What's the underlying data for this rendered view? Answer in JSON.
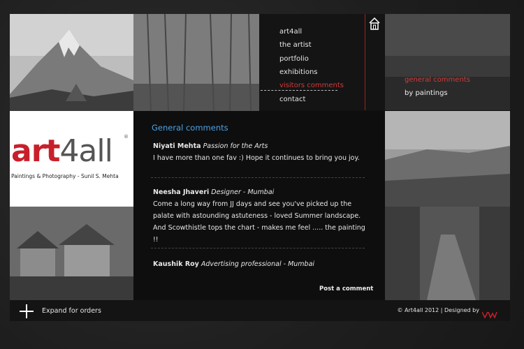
{
  "brand": {
    "logo_word_a": "art",
    "logo_word_b": "4all",
    "logo_reg": "®",
    "logo_subtitle": "Paintings & Photography - Sunil S. Mehta",
    "brand_color": "#c8202b"
  },
  "nav": {
    "items": [
      {
        "label": "art4all"
      },
      {
        "label": "the artist"
      },
      {
        "label": "portfolio"
      },
      {
        "label": "exhibitions"
      },
      {
        "label": "visitors comments"
      },
      {
        "label": "contact"
      }
    ],
    "active_index": 4,
    "home_icon": "home-icon",
    "active_color": "#d23a3a"
  },
  "subnav": {
    "items": [
      {
        "label": "general comments"
      },
      {
        "label": "by paintings"
      }
    ]
  },
  "content": {
    "title": "General comments",
    "title_color": "#4ba3e8",
    "comments": [
      {
        "name": "Niyati Mehta",
        "role": "Passion for the Arts",
        "text": "I have more than one fav :) Hope it continues to bring you joy."
      },
      {
        "name": "Neesha Jhaveri",
        "role": "Designer - Mumbai",
        "text": "Come a long way from JJ days and see you've picked up the palate with astounding astuteness - loved Summer landscape. And Scowthistle tops the chart - makes me feel ..... the painting !!"
      },
      {
        "name": "Kaushik Roy",
        "role": "Advertising professional - Mumbai",
        "text": ""
      }
    ],
    "post_label": "Post a comment"
  },
  "footer": {
    "expand_label": "Expand for orders",
    "copyright": "© Art4all 2012 | Designed by",
    "designer_logo": "vw-logo-icon"
  }
}
